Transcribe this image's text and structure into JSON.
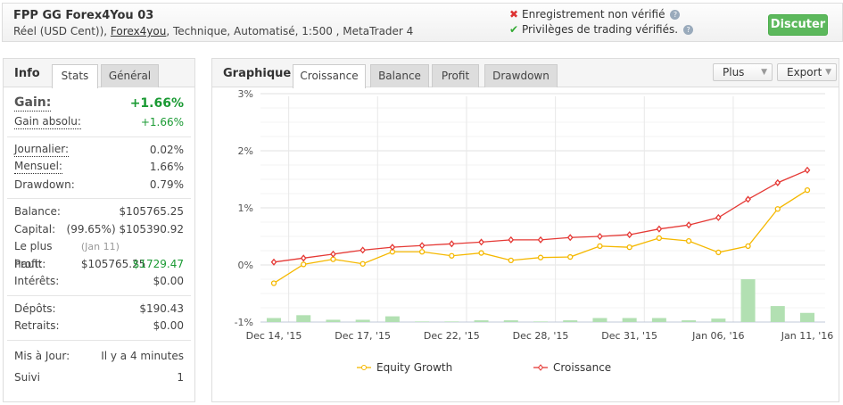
{
  "header": {
    "title": "FPP GG Forex4You 03",
    "sub_pre": "Réel (USD Cent)), ",
    "broker": "Forex4you",
    "sub_post": ", Technique, Automatisé, 1:500 , MetaTrader 4",
    "verif1": "Enregistrement non vérifié",
    "verif2": "Privilèges de trading vérifiés.",
    "help": "?",
    "discuss": "Discuter"
  },
  "left": {
    "tab_head": "Info",
    "tabs": [
      "Stats",
      "Général"
    ],
    "gain_label": "Gain:",
    "gain": "+1.66%",
    "abs_label": "Gain absolu:",
    "abs": "+1.66%",
    "daily_label": "Journalier:",
    "daily": "0.02%",
    "monthly_label": "Mensuel:",
    "monthly": "1.66%",
    "dd_label": "Drawdown:",
    "dd": "0.79%",
    "balance_label": "Balance:",
    "balance": "$105765.25",
    "equity_label": "Capital:",
    "equity_pct": "(99.65%)",
    "equity": "$105390.92",
    "high_label": "Le plus haut:",
    "high_date": "(Jan 11)",
    "high": "$105765.25",
    "profit_label": "Profit:",
    "profit": "$1729.47",
    "interest_label": "Intérêts:",
    "interest": "$0.00",
    "dep_label": "Dépôts:",
    "dep": "$190.43",
    "wd_label": "Retraits:",
    "wd": "$0.00",
    "upd_label": "Mis à Jour:",
    "upd": "Il y a 4 minutes",
    "follow_label": "Suivi",
    "follow": "1"
  },
  "right": {
    "tab_head": "Graphique",
    "tabs": [
      "Croissance",
      "Balance",
      "Profit",
      "Drawdown"
    ],
    "more": "Plus",
    "export": "Export"
  },
  "colors": {
    "equity": "#f5b800",
    "growth": "#e53935",
    "bars": "#b2e0b2"
  },
  "chart_data": {
    "type": "line",
    "ylim": [
      -1,
      3
    ],
    "yticks": [
      "3%",
      "2%",
      "1%",
      "0%",
      "-1%"
    ],
    "xlabels": [
      {
        "i": 0,
        "t": "Dec 14, '15"
      },
      {
        "i": 3,
        "t": "Dec 17, '15"
      },
      {
        "i": 6,
        "t": "Dec 22, '15"
      },
      {
        "i": 9,
        "t": "Dec 28, '15"
      },
      {
        "i": 12,
        "t": "Dec 31, '15"
      },
      {
        "i": 15,
        "t": "Jan 06, '16"
      },
      {
        "i": 18,
        "t": "Jan 11, '16"
      }
    ],
    "series": [
      {
        "name": "Equity Growth",
        "values": [
          -0.32,
          0.01,
          0.1,
          0.02,
          0.23,
          0.23,
          0.16,
          0.21,
          0.08,
          0.13,
          0.14,
          0.33,
          0.31,
          0.47,
          0.42,
          0.22,
          0.33,
          0.98,
          1.31
        ]
      },
      {
        "name": "Croissance",
        "values": [
          0.05,
          0.12,
          0.19,
          0.26,
          0.31,
          0.34,
          0.37,
          0.4,
          0.44,
          0.44,
          0.48,
          0.5,
          0.53,
          0.63,
          0.7,
          0.83,
          1.15,
          1.44,
          1.66
        ]
      }
    ],
    "bars": [
      0.07,
      0.12,
      0.04,
      0.04,
      0.1,
      0.01,
      0.01,
      0.03,
      0.03,
      0.01,
      0.03,
      0.07,
      0.07,
      0.07,
      0.03,
      0.06,
      0.75,
      0.28,
      0.16
    ]
  }
}
